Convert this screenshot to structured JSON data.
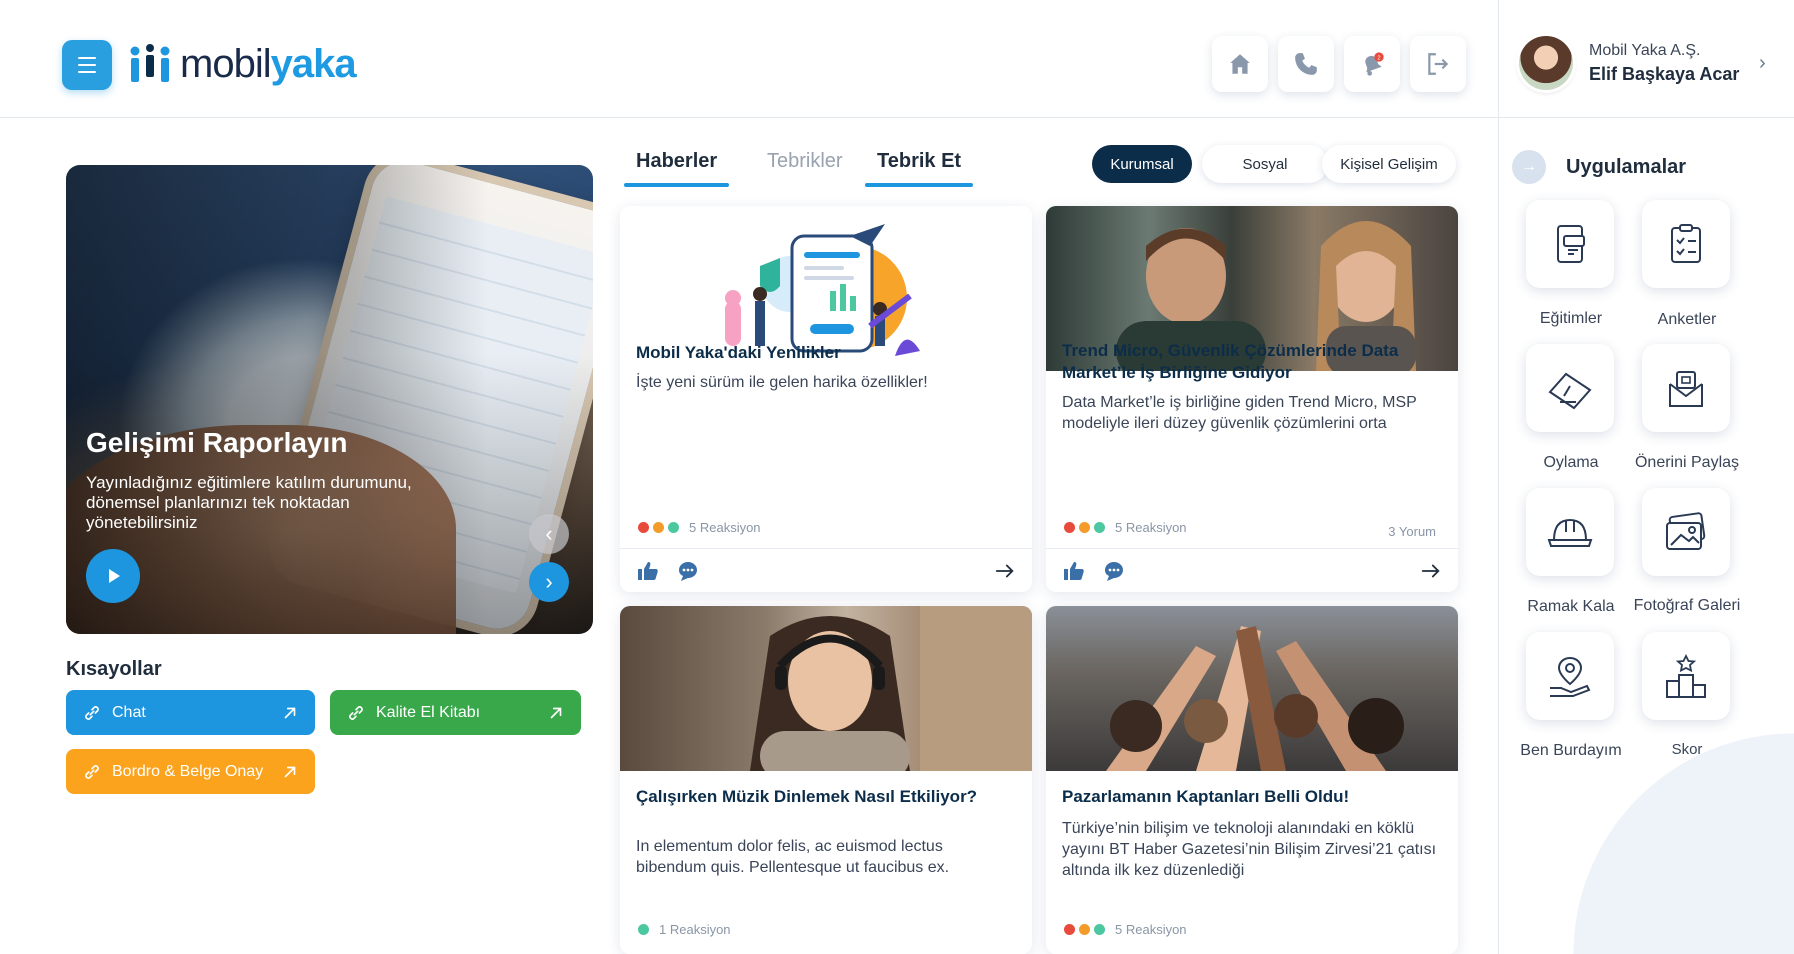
{
  "brand": {
    "logo_plain": "mobil",
    "logo_bold": "yaka",
    "accent": "#1e96df",
    "dark": "#0c2d4a"
  },
  "header": {
    "icons": [
      "home-icon",
      "phone-icon",
      "notification-bell-icon",
      "logout-icon"
    ]
  },
  "profile": {
    "company": "Mobil Yaka A.Ş.",
    "name": "Elif Başkaya Acar"
  },
  "hero": {
    "title": "Gelişimi Raporlayın",
    "description": "Yayınladığınız eğitimlere katılım durumunu, dönemsel planlarınızı tek noktadan yönetebilirsiniz"
  },
  "shortcuts": {
    "title": "Kısayollar",
    "items": [
      {
        "label": "Chat",
        "color": "#1e96df"
      },
      {
        "label": "Kalite El Kitabı",
        "color": "#38a84a"
      },
      {
        "label": "Bordro & Belge Onay",
        "color": "#fba31d"
      }
    ]
  },
  "tabs": [
    "Haberler",
    "Tebrikler",
    "Tebrik Et"
  ],
  "filters": [
    "Kurumsal",
    "Sosyal",
    "Kişisel Gelişim"
  ],
  "cards": [
    {
      "title": "Mobil Yaka'daki Yenilikler",
      "description": "İşte yeni sürüm ile gelen harika özellikler!",
      "reactions": "5 Reaksiyon",
      "comments": ""
    },
    {
      "title": "Trend Micro, Güvenlik Çözümlerinde Data Market’le İş Birliğine Gidiyor",
      "description": "Data Market’le iş birliğine giden Trend Micro, MSP modeliyle ileri düzey güvenlik çözümlerini orta",
      "reactions": "5 Reaksiyon",
      "comments": "3 Yorum"
    },
    {
      "title": "Çalışırken Müzik Dinlemek Nasıl Etkiliyor?",
      "description": "In elementum dolor felis, ac euismod lectus bibendum quis. Pellentesque ut faucibus ex.",
      "reactions": "1 Reaksiyon",
      "comments": ""
    },
    {
      "title": "Pazarlamanın Kaptanları Belli Oldu!",
      "description": "Türkiye’nin bilişim ve teknoloji alanındaki en köklü yayını BT Haber Gazetesi’nin Bilişim Zirvesi’21 çatısı altında ilk kez düzenlediği",
      "reactions": "5 Reaksiyon",
      "comments": ""
    }
  ],
  "apps": {
    "title": "Uygulamalar",
    "items": [
      {
        "label": "Eğitimler",
        "icon": "training-icon"
      },
      {
        "label": "Anketler",
        "icon": "survey-icon"
      },
      {
        "label": "Oylama",
        "icon": "voting-icon"
      },
      {
        "label": "Önerini Paylaş",
        "icon": "suggestion-icon"
      },
      {
        "label": "Ramak Kala",
        "icon": "hard-hat-icon"
      },
      {
        "label": "Fotoğraf Galeri",
        "icon": "photo-gallery-icon"
      },
      {
        "label": "Ben Burdayım",
        "icon": "location-icon"
      },
      {
        "label": "Skor",
        "icon": "podium-icon"
      }
    ]
  }
}
